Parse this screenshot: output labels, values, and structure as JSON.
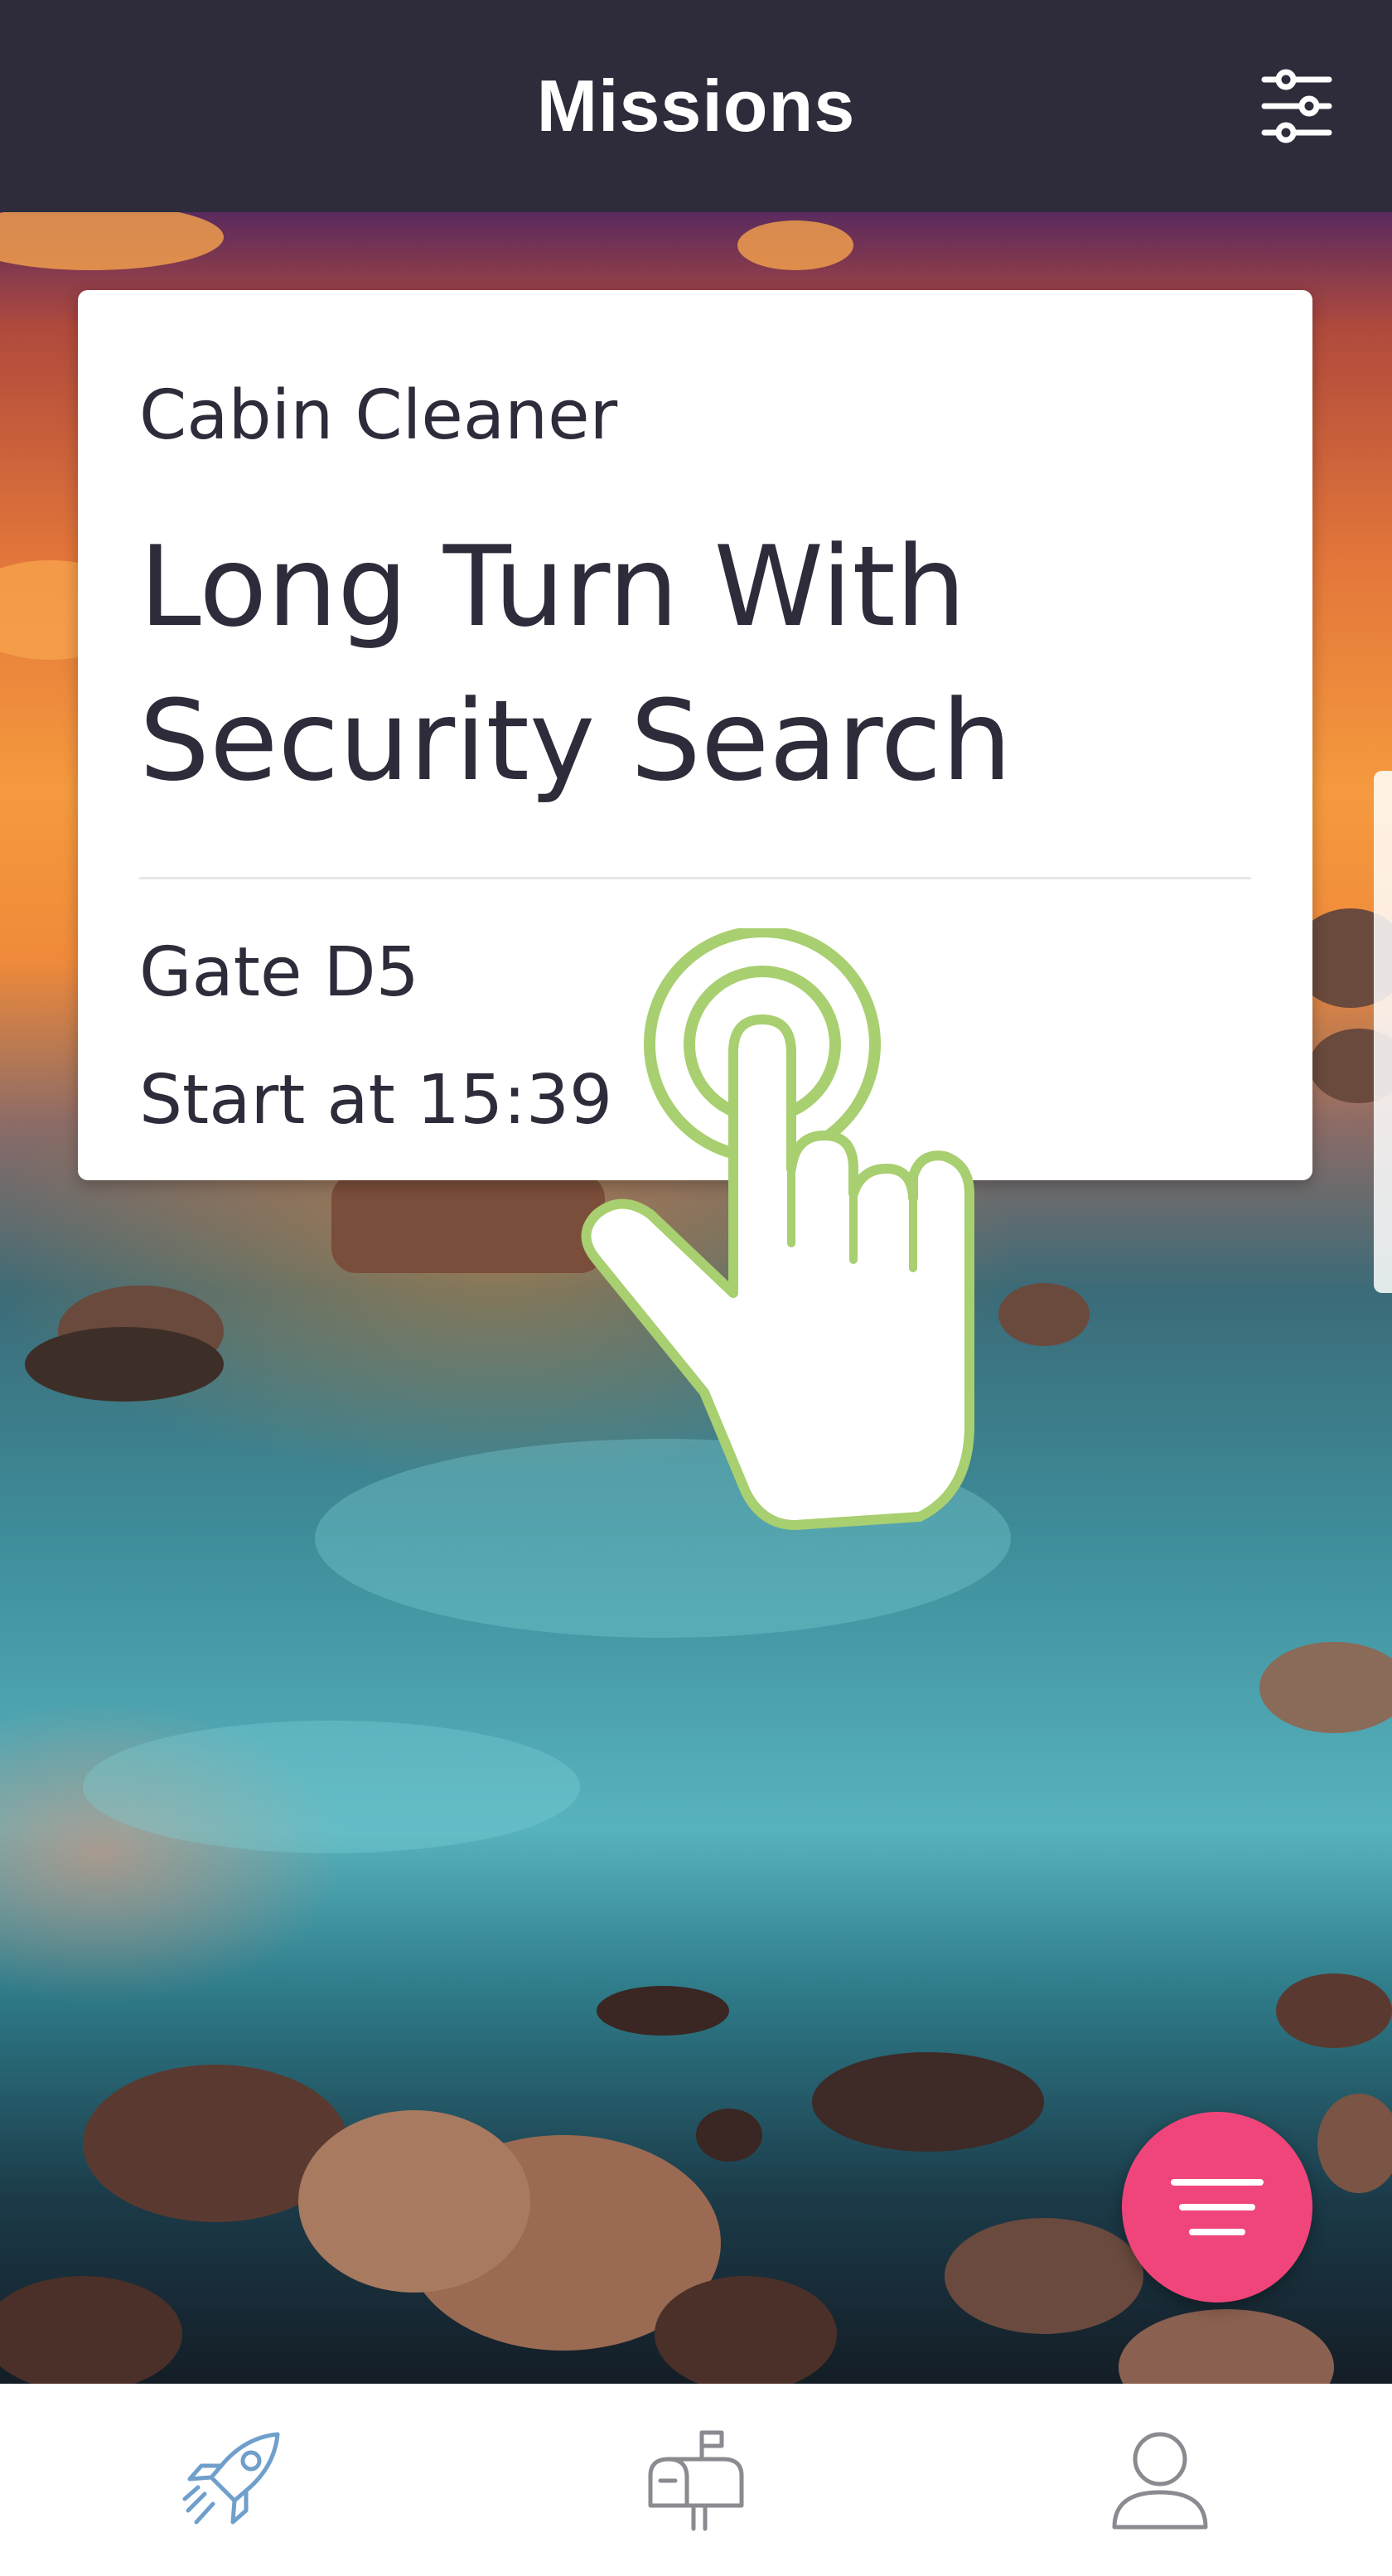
{
  "header": {
    "title": "Missions",
    "filter_icon": "sliders-icon"
  },
  "mission_card": {
    "role": "Cabin Cleaner",
    "title": "Long Turn With Security Search",
    "gate": "Gate D5",
    "start": "Start at 15:39"
  },
  "fab": {
    "icon": "menu-lines-icon",
    "color": "#f0457a"
  },
  "bottom_nav": {
    "items": [
      {
        "icon": "rocket-icon",
        "active": true
      },
      {
        "icon": "mailbox-icon",
        "active": false
      },
      {
        "icon": "user-icon",
        "active": false
      }
    ]
  },
  "colors": {
    "header_bg": "#2e2c3a",
    "text": "#2e2c3a",
    "accent_blue": "#6f9fca",
    "tap_hint_green": "#a8cf70"
  }
}
